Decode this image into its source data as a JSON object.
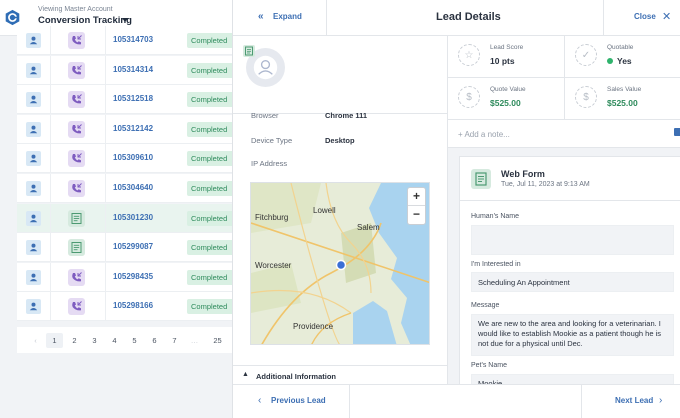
{
  "account": {
    "subtitle": "Viewing Master Account",
    "title": "Conversion Tracking"
  },
  "leads": [
    {
      "id": "105314703",
      "type": "call",
      "status": "Completed"
    },
    {
      "id": "105314314",
      "type": "call",
      "status": "Completed"
    },
    {
      "id": "105312518",
      "type": "call",
      "status": "Completed"
    },
    {
      "id": "105312142",
      "type": "call",
      "status": "Completed"
    },
    {
      "id": "105309610",
      "type": "call",
      "status": "Completed"
    },
    {
      "id": "105304640",
      "type": "call",
      "status": "Completed"
    },
    {
      "id": "105301230",
      "type": "form",
      "status": "Completed"
    },
    {
      "id": "105299087",
      "type": "form",
      "status": "Completed"
    },
    {
      "id": "105298435",
      "type": "call",
      "status": "Completed"
    },
    {
      "id": "105298166",
      "type": "call",
      "status": "Completed"
    }
  ],
  "pagination": {
    "prev": "‹",
    "pages": [
      "1",
      "2",
      "3",
      "4",
      "5",
      "6",
      "7",
      "…",
      "25"
    ],
    "active": "1"
  },
  "panel": {
    "expand_label": "Expand",
    "title": "Lead Details",
    "close_label": "Close",
    "details": {
      "browser_label": "Browser",
      "browser_value": "Chrome 111",
      "device_label": "Device Type",
      "device_value": "Desktop",
      "ip_label": "IP Address"
    },
    "map": {
      "cities": [
        "Fitchburg",
        "Lowell",
        "Salem",
        "Worcester",
        "Providence"
      ]
    },
    "additional_label": "Additional Information",
    "metrics": {
      "lead_score_label": "Lead Score",
      "lead_score_value": "10 pts",
      "quotable_label": "Quotable",
      "quotable_value": "Yes",
      "quote_value_label": "Quote Value",
      "quote_value_value": "$525.00",
      "sales_value_label": "Sales Value",
      "sales_value_value": "$525.00"
    },
    "note_placeholder": "+ Add a note...",
    "form": {
      "title": "Web Form",
      "date": "Tue, Jul 11, 2023 at 9:13 AM",
      "fields": [
        {
          "label": "Human's Name",
          "value": ""
        },
        {
          "label": "I'm Interested in",
          "value": "Scheduling An Appointment"
        },
        {
          "label": "Message",
          "value": "We are new to the area and looking for a veterinarian. I would like to establish Mookie as a patient though he is not due for a physical until Dec."
        },
        {
          "label": "Pet's Name",
          "value": "Mookie"
        }
      ]
    },
    "prev_label": "Previous Lead",
    "next_label": "Next Lead"
  },
  "colors": {
    "accent": "#3d6fb3",
    "success": "#2e8b5c",
    "status_bg": "#d9f0e3"
  }
}
